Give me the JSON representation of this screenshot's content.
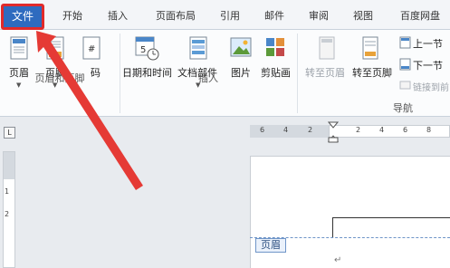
{
  "tabs": {
    "file": "文件",
    "home": "开始",
    "insert": "插入",
    "layout": "页面布局",
    "references": "引用",
    "mailings": "邮件",
    "review": "审阅",
    "view": "视图",
    "baidu": "百度网盘"
  },
  "ribbon": {
    "header_btn": "页眉",
    "footer_btn": "页脚",
    "page_number_btn": "码",
    "datetime_btn": "日期和时间",
    "docparts_btn": "文档部件",
    "picture_btn": "图片",
    "clipart_btn": "剪贴画",
    "goto_header_btn": "转至页眉",
    "goto_footer_btn": "转至页脚",
    "prev_section_btn": "上一节",
    "next_section_btn": "下一节",
    "link_prev_btn": "链接到前",
    "group_header_footer": "页眉和页脚",
    "group_insert": "插入",
    "group_navigation": "导航"
  },
  "ruler": {
    "corner": "L",
    "h_numbers": [
      "6",
      "4",
      "2",
      "2",
      "4",
      "6",
      "8"
    ],
    "v_numbers": [
      "1",
      "2"
    ]
  },
  "document": {
    "header_tag": "页眉",
    "paragraph_mark": "↵"
  },
  "colors": {
    "file_tab": "#2e6bbf",
    "highlight": "#e02a2a",
    "arrow": "#e53a35"
  }
}
